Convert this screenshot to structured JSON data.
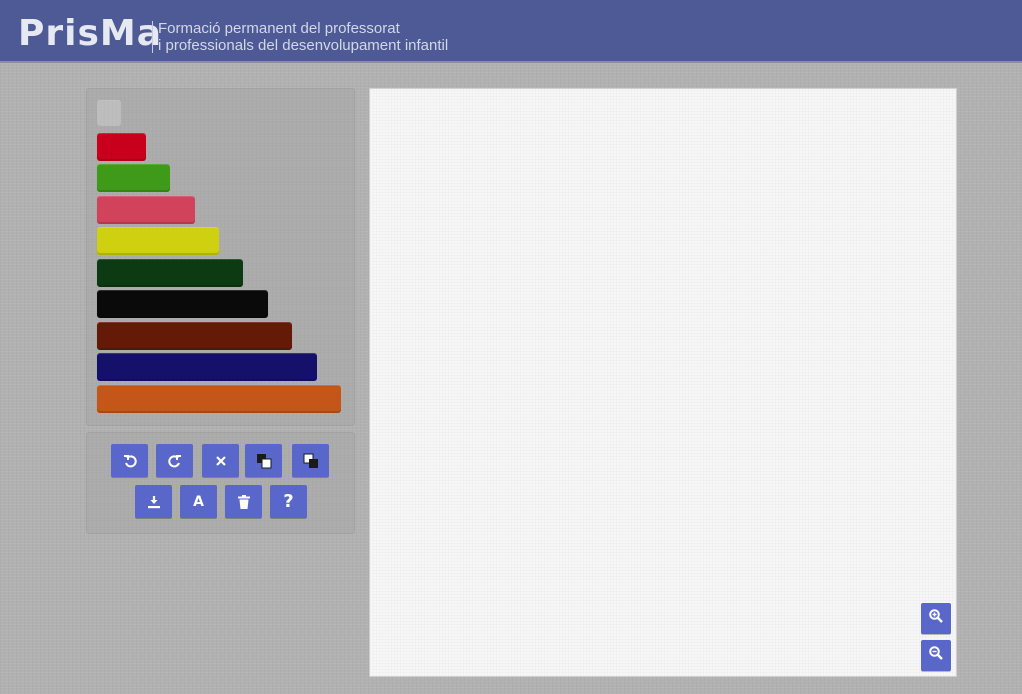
{
  "header": {
    "logo_text": "PrisMa",
    "tagline_line1": "Formació permanent del professorat",
    "tagline_line2": "i professionals del desenvolupament infantil",
    "background_color": "#4d5a96"
  },
  "palette": {
    "rods": [
      {
        "name": "rod-1",
        "length_units": 1,
        "color": "#c9c9c9"
      },
      {
        "name": "rod-2",
        "length_units": 2,
        "color": "#c8001b"
      },
      {
        "name": "rod-3",
        "length_units": 3,
        "color": "#3f9a1a"
      },
      {
        "name": "rod-4",
        "length_units": 4,
        "color": "#d1435a"
      },
      {
        "name": "rod-5",
        "length_units": 5,
        "color": "#cfd010"
      },
      {
        "name": "rod-6",
        "length_units": 6,
        "color": "#0c3a12"
      },
      {
        "name": "rod-7",
        "length_units": 7,
        "color": "#0a0a0a"
      },
      {
        "name": "rod-8",
        "length_units": 8,
        "color": "#651a08"
      },
      {
        "name": "rod-9",
        "length_units": 9,
        "color": "#15106a"
      },
      {
        "name": "rod-10",
        "length_units": 10,
        "color": "#c4561a"
      }
    ]
  },
  "toolbar": {
    "row1": [
      {
        "name": "undo-button",
        "icon": "undo-icon"
      },
      {
        "name": "redo-button",
        "icon": "redo-icon"
      },
      {
        "name": "delete-button",
        "icon": "close-icon"
      },
      {
        "name": "bring-front-button",
        "icon": "bring-to-front-icon"
      },
      {
        "name": "send-back-button",
        "icon": "send-to-back-icon"
      }
    ],
    "row2": [
      {
        "name": "download-button",
        "icon": "download-icon"
      },
      {
        "name": "text-button",
        "icon": "text-icon",
        "label": "A"
      },
      {
        "name": "clear-button",
        "icon": "trash-icon"
      },
      {
        "name": "help-button",
        "icon": "help-icon",
        "label": "?"
      }
    ],
    "button_color": "#5867c9"
  },
  "canvas": {
    "zoom_in_icon": "zoom-in-icon",
    "zoom_out_icon": "zoom-out-icon"
  }
}
